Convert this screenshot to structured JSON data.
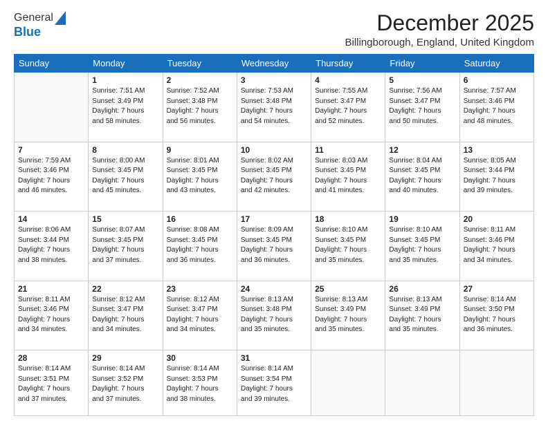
{
  "logo": {
    "line1": "General",
    "line2": "Blue"
  },
  "title": "December 2025",
  "location": "Billingborough, England, United Kingdom",
  "weekdays": [
    "Sunday",
    "Monday",
    "Tuesday",
    "Wednesday",
    "Thursday",
    "Friday",
    "Saturday"
  ],
  "weeks": [
    [
      {
        "day": "",
        "info": ""
      },
      {
        "day": "1",
        "info": "Sunrise: 7:51 AM\nSunset: 3:49 PM\nDaylight: 7 hours\nand 58 minutes."
      },
      {
        "day": "2",
        "info": "Sunrise: 7:52 AM\nSunset: 3:48 PM\nDaylight: 7 hours\nand 56 minutes."
      },
      {
        "day": "3",
        "info": "Sunrise: 7:53 AM\nSunset: 3:48 PM\nDaylight: 7 hours\nand 54 minutes."
      },
      {
        "day": "4",
        "info": "Sunrise: 7:55 AM\nSunset: 3:47 PM\nDaylight: 7 hours\nand 52 minutes."
      },
      {
        "day": "5",
        "info": "Sunrise: 7:56 AM\nSunset: 3:47 PM\nDaylight: 7 hours\nand 50 minutes."
      },
      {
        "day": "6",
        "info": "Sunrise: 7:57 AM\nSunset: 3:46 PM\nDaylight: 7 hours\nand 48 minutes."
      }
    ],
    [
      {
        "day": "7",
        "info": "Sunrise: 7:59 AM\nSunset: 3:46 PM\nDaylight: 7 hours\nand 46 minutes."
      },
      {
        "day": "8",
        "info": "Sunrise: 8:00 AM\nSunset: 3:45 PM\nDaylight: 7 hours\nand 45 minutes."
      },
      {
        "day": "9",
        "info": "Sunrise: 8:01 AM\nSunset: 3:45 PM\nDaylight: 7 hours\nand 43 minutes."
      },
      {
        "day": "10",
        "info": "Sunrise: 8:02 AM\nSunset: 3:45 PM\nDaylight: 7 hours\nand 42 minutes."
      },
      {
        "day": "11",
        "info": "Sunrise: 8:03 AM\nSunset: 3:45 PM\nDaylight: 7 hours\nand 41 minutes."
      },
      {
        "day": "12",
        "info": "Sunrise: 8:04 AM\nSunset: 3:45 PM\nDaylight: 7 hours\nand 40 minutes."
      },
      {
        "day": "13",
        "info": "Sunrise: 8:05 AM\nSunset: 3:44 PM\nDaylight: 7 hours\nand 39 minutes."
      }
    ],
    [
      {
        "day": "14",
        "info": "Sunrise: 8:06 AM\nSunset: 3:44 PM\nDaylight: 7 hours\nand 38 minutes."
      },
      {
        "day": "15",
        "info": "Sunrise: 8:07 AM\nSunset: 3:45 PM\nDaylight: 7 hours\nand 37 minutes."
      },
      {
        "day": "16",
        "info": "Sunrise: 8:08 AM\nSunset: 3:45 PM\nDaylight: 7 hours\nand 36 minutes."
      },
      {
        "day": "17",
        "info": "Sunrise: 8:09 AM\nSunset: 3:45 PM\nDaylight: 7 hours\nand 36 minutes."
      },
      {
        "day": "18",
        "info": "Sunrise: 8:10 AM\nSunset: 3:45 PM\nDaylight: 7 hours\nand 35 minutes."
      },
      {
        "day": "19",
        "info": "Sunrise: 8:10 AM\nSunset: 3:45 PM\nDaylight: 7 hours\nand 35 minutes."
      },
      {
        "day": "20",
        "info": "Sunrise: 8:11 AM\nSunset: 3:46 PM\nDaylight: 7 hours\nand 34 minutes."
      }
    ],
    [
      {
        "day": "21",
        "info": "Sunrise: 8:11 AM\nSunset: 3:46 PM\nDaylight: 7 hours\nand 34 minutes."
      },
      {
        "day": "22",
        "info": "Sunrise: 8:12 AM\nSunset: 3:47 PM\nDaylight: 7 hours\nand 34 minutes."
      },
      {
        "day": "23",
        "info": "Sunrise: 8:12 AM\nSunset: 3:47 PM\nDaylight: 7 hours\nand 34 minutes."
      },
      {
        "day": "24",
        "info": "Sunrise: 8:13 AM\nSunset: 3:48 PM\nDaylight: 7 hours\nand 35 minutes."
      },
      {
        "day": "25",
        "info": "Sunrise: 8:13 AM\nSunset: 3:49 PM\nDaylight: 7 hours\nand 35 minutes."
      },
      {
        "day": "26",
        "info": "Sunrise: 8:13 AM\nSunset: 3:49 PM\nDaylight: 7 hours\nand 35 minutes."
      },
      {
        "day": "27",
        "info": "Sunrise: 8:14 AM\nSunset: 3:50 PM\nDaylight: 7 hours\nand 36 minutes."
      }
    ],
    [
      {
        "day": "28",
        "info": "Sunrise: 8:14 AM\nSunset: 3:51 PM\nDaylight: 7 hours\nand 37 minutes."
      },
      {
        "day": "29",
        "info": "Sunrise: 8:14 AM\nSunset: 3:52 PM\nDaylight: 7 hours\nand 37 minutes."
      },
      {
        "day": "30",
        "info": "Sunrise: 8:14 AM\nSunset: 3:53 PM\nDaylight: 7 hours\nand 38 minutes."
      },
      {
        "day": "31",
        "info": "Sunrise: 8:14 AM\nSunset: 3:54 PM\nDaylight: 7 hours\nand 39 minutes."
      },
      {
        "day": "",
        "info": ""
      },
      {
        "day": "",
        "info": ""
      },
      {
        "day": "",
        "info": ""
      }
    ]
  ]
}
